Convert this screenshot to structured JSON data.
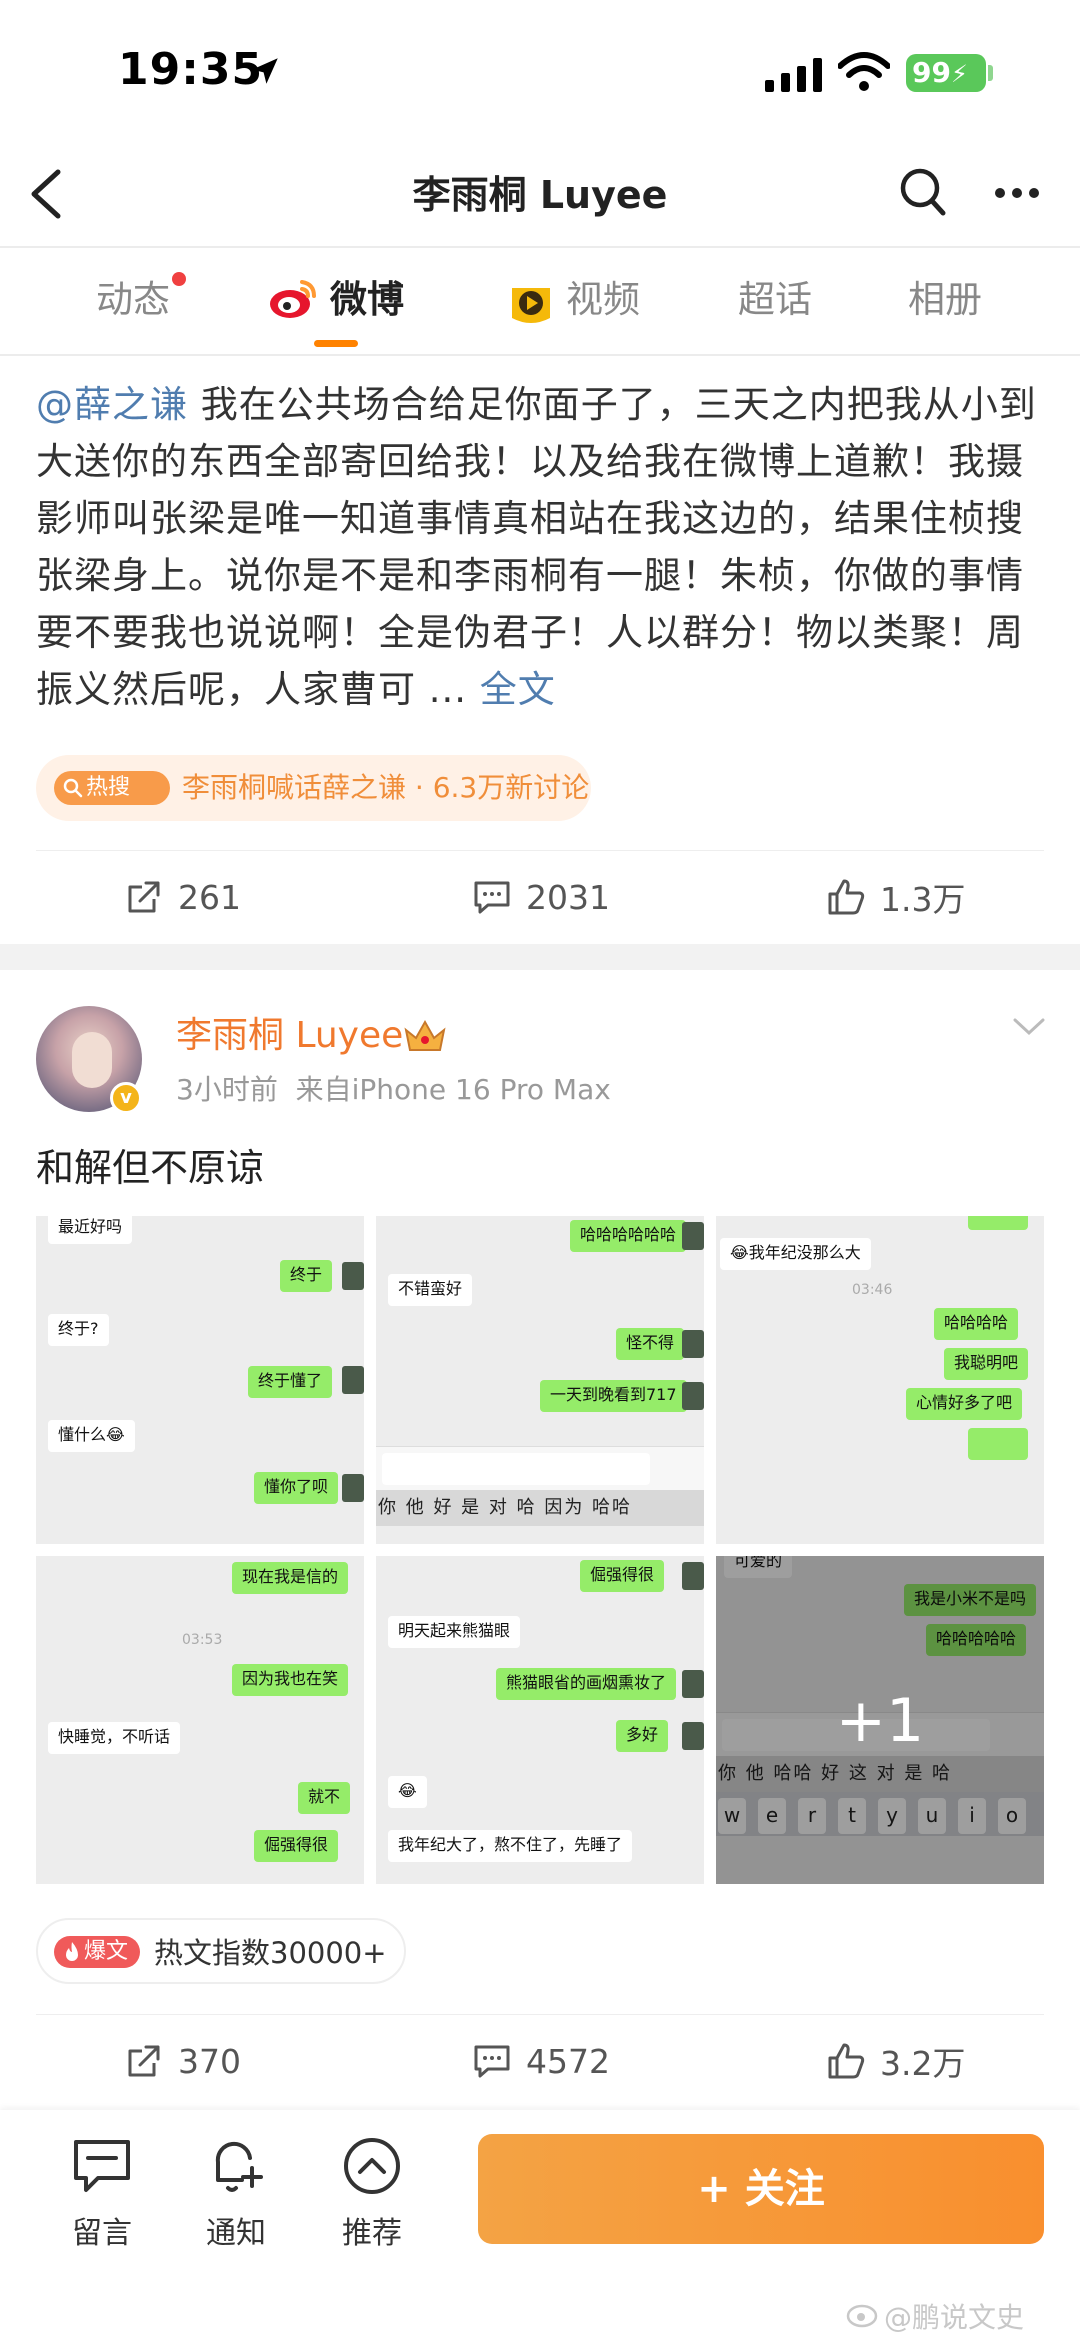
{
  "status_bar": {
    "time": "19:35",
    "battery": "99"
  },
  "header": {
    "title": "李雨桐 Luyee"
  },
  "tabs": [
    {
      "label": "动态"
    },
    {
      "label": "微博"
    },
    {
      "label": "视频"
    },
    {
      "label": "超话"
    },
    {
      "label": "相册"
    }
  ],
  "post1": {
    "mention": "@薛之谦",
    "text": " 我在公共场合给足你面子了，三天之内把我从小到大送你的东西全部寄回给我！以及给我在微博上道歉！我摄影师叫张梁是唯一知道事情真相站在我这边的，结果住桢搜张梁身上。说你是不是和李雨桐有一腿！朱桢，你做的事情要不要我也说说啊！全是伪君子！人以群分！物以类聚！周振义然后呢，人家曹可 ...",
    "more_link": " 全文",
    "hot_badge": "热搜",
    "hot_text": "李雨桐喊话薛之谦 · 6.3万新讨论",
    "shares": "261",
    "comments": "2031",
    "likes": "1.3万"
  },
  "post2": {
    "author": "李雨桐 Luyee",
    "time": "3小时前",
    "source": "来自iPhone 16 Pro Max",
    "text": "和解但不原谅",
    "more_count": "+1",
    "images": {
      "img1": [
        "最近好吗",
        "终于",
        "终于?",
        "终于懂了",
        "懂什么😂",
        "懂你了呗"
      ],
      "img2": [
        "哈哈哈哈哈哈",
        "不错蛮好",
        "怪不得",
        "一天到晚看到717"
      ],
      "img2_candidates": "你  他  好  是  对  哈  因为  哈哈",
      "img3": [
        "😂我年纪没那么大",
        "03:46",
        "哈哈哈哈",
        "我聪明吧",
        "心情好多了吧"
      ],
      "img4": [
        "现在我是信的",
        "03:53",
        "因为我也在笑",
        "快睡觉，不听话",
        "就不",
        "倔强得很"
      ],
      "img5": [
        "倔强得很",
        "明天起来熊猫眼",
        "熊猫眼省的画烟熏妆了",
        "多好",
        "😂",
        "我年纪大了，熬不住了，先睡了"
      ],
      "img6": [
        "可爱的",
        "我是小米不是吗",
        "哈哈哈哈哈"
      ],
      "img6_candidates": "你  他  哈哈  好  这  对  是  哈",
      "img6_keys": [
        "w",
        "e",
        "r",
        "t",
        "y",
        "u",
        "i",
        "o"
      ]
    },
    "badge": "爆文",
    "badge_text": "热文指数30000+",
    "shares": "370",
    "comments": "4572",
    "likes": "3.2万"
  },
  "bottom_bar": {
    "comment_label": "留言",
    "notify_label": "通知",
    "recommend_label": "推荐",
    "follow_label": "+ 关注"
  },
  "watermark": "@鹏说文史",
  "colors": {
    "accent": "#ff8200",
    "link": "#507daf",
    "author": "#f0792e",
    "follow_button": "#f98f2e"
  },
  "icons": [
    "location-arrow-icon",
    "signal-icon",
    "wifi-icon",
    "battery-icon",
    "back-icon",
    "search-icon",
    "more-icon",
    "weibo-logo-icon",
    "video-icon",
    "share-icon",
    "comment-icon",
    "like-icon",
    "crown-icon",
    "chevron-down-icon",
    "comment-bubble-icon",
    "bell-plus-icon",
    "up-arrow-circle-icon"
  ]
}
